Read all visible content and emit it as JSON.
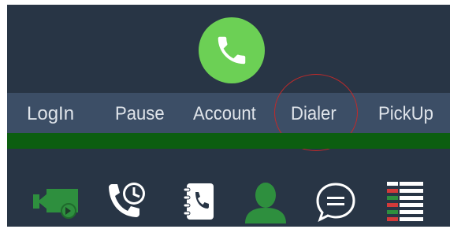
{
  "call_button": {
    "icon": "phone-icon",
    "color": "#6cd055"
  },
  "menu": {
    "items": [
      {
        "label": "LogIn"
      },
      {
        "label": "Pause"
      },
      {
        "label": "Account"
      },
      {
        "label": "Dialer",
        "highlighted": true
      },
      {
        "label": "PickUp"
      }
    ]
  },
  "status_bar": {
    "color": "#0c5e10"
  },
  "toolbar": {
    "icons": [
      {
        "name": "video-call-icon",
        "color": "#2e8f3e"
      },
      {
        "name": "call-history-icon",
        "color": "#ffffff"
      },
      {
        "name": "contacts-book-icon",
        "color": "#ffffff"
      },
      {
        "name": "user-icon",
        "color": "#2e8f3e"
      },
      {
        "name": "chat-icon",
        "color": "#ffffff"
      },
      {
        "name": "queue-list-icon",
        "colors": [
          "#ffffff",
          "#2e8f3e",
          "#d33a3a"
        ]
      }
    ]
  },
  "theme": {
    "background": "#283545",
    "menu_background": "#3c4e66",
    "menu_text": "#dfe4ea",
    "annotation_circle": "#c02a2a"
  }
}
